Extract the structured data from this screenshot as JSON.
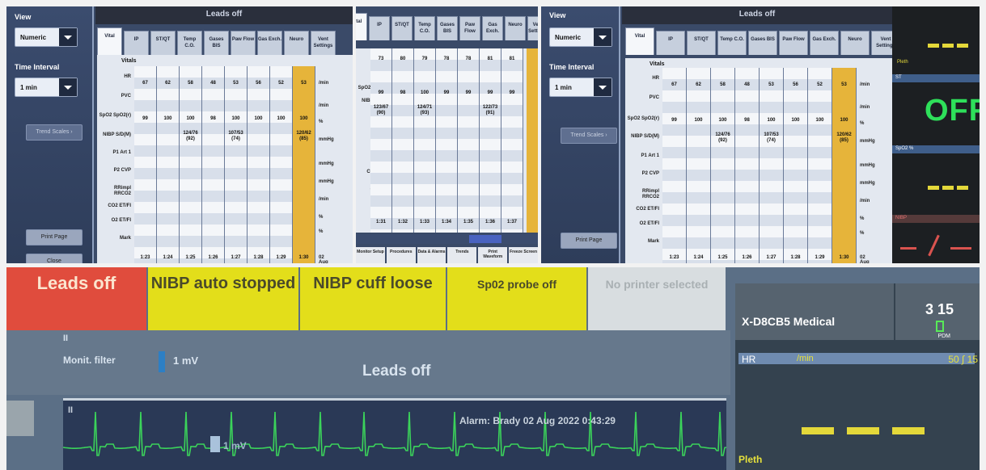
{
  "sidebar": {
    "view_label": "View",
    "view_value": "Numeric",
    "time_label": "Time Interval",
    "time_value": "1 min",
    "trend_scales": "Trend Scales",
    "print_page": "Print Page",
    "close": "Close"
  },
  "topbar": {
    "title": "Leads off"
  },
  "tabs": [
    "Vital",
    "IP",
    "ST/QT",
    "Temp C.O.",
    "Gases BIS",
    "Paw Flow",
    "Gas Exch.",
    "Neuro",
    "Vent Settings"
  ],
  "vitals_header": "Vitals",
  "row_labels": [
    "HR",
    "PVC",
    "SpO2 SpO2(r)",
    "NIBP S/D(M)",
    "P1 Art 1",
    "P2 CVP",
    "RRimpl RRCO2",
    "CO2 ET/FI",
    "O2 ET/FI",
    "Mark"
  ],
  "units": [
    "/min",
    "/min",
    "%",
    "mmHg",
    "mmHg",
    "mmHg",
    "/min",
    "%",
    "%"
  ],
  "columns": [
    {
      "time": "1:23",
      "hr": "67",
      "spo2": "99",
      "nibp": ""
    },
    {
      "time": "1:24",
      "hr": "62",
      "spo2": "100",
      "nibp": ""
    },
    {
      "time": "1:25",
      "hr": "58",
      "spo2": "100",
      "nibp": "124/76 (92)"
    },
    {
      "time": "1:26",
      "hr": "48",
      "spo2": "98",
      "nibp": ""
    },
    {
      "time": "1:27",
      "hr": "53",
      "spo2": "100",
      "nibp": "107/53 (74)"
    },
    {
      "time": "1:28",
      "hr": "56",
      "spo2": "100",
      "nibp": ""
    },
    {
      "time": "1:29",
      "hr": "52",
      "spo2": "100",
      "nibp": ""
    },
    {
      "time": "1:30",
      "hr": "53",
      "spo2": "100",
      "nibp": "120/62 (85)"
    }
  ],
  "date_label": "02 Aug",
  "p2": {
    "row_labels": [
      "HR",
      "PVC",
      "SpO2 SpO2(r)",
      "NIBP S/D(M)",
      "P1 Art 1",
      "P2 CVP",
      "RRimpl RRCO2",
      "CO2 ET/FI",
      "O2 ET/FI",
      "Mark"
    ],
    "columns": [
      {
        "time": "1:31",
        "hr": "73",
        "spo2": "99",
        "nibp": "123/67 (90)"
      },
      {
        "time": "1:32",
        "hr": "80",
        "spo2": "98",
        "nibp": ""
      },
      {
        "time": "1:33",
        "hr": "79",
        "spo2": "100",
        "nibp": "124/71 (93)"
      },
      {
        "time": "1:34",
        "hr": "78",
        "spo2": "99",
        "nibp": ""
      },
      {
        "time": "1:35",
        "hr": "78",
        "spo2": "99",
        "nibp": ""
      },
      {
        "time": "1:36",
        "hr": "81",
        "spo2": "99",
        "nibp": "122/73 (91)"
      },
      {
        "time": "1:37",
        "hr": "81",
        "spo2": "99",
        "nibp": ""
      }
    ],
    "footer_tabs": [
      "Monitor Setup",
      "Procedures",
      "Data & Alarms",
      "Trends",
      "Print Waveform",
      "Freeze Screen"
    ]
  },
  "p3": {
    "off_value": "OFF",
    "pleth": "Pleth",
    "st_label": "ST",
    "spo2_label": "SpO2  %",
    "nibp_label": "NIBP"
  },
  "alarms": [
    {
      "text": "Leads off",
      "color": "#e04c3d"
    },
    {
      "text": "NIBP auto stopped",
      "color": "#e3de1a"
    },
    {
      "text": "NIBP cuff loose",
      "color": "#e3de1a"
    },
    {
      "text": "Sp02 probe off",
      "color": "#e3de1a"
    },
    {
      "text": "No printer selected",
      "color": "#d8dde0"
    }
  ],
  "device": {
    "name": "X-D8CB5 Medical",
    "clock": "3 15",
    "battery_label": "PDM",
    "hr_label": "HR",
    "hr_unit": "/min",
    "hr_limits": "50 ∫ 15",
    "pleth_label": "Pleth"
  },
  "ecg": {
    "lead_top": "II",
    "filter_label": "Monit. filter",
    "filter_value": "1 mV",
    "leads_off": "Leads off",
    "wave_lead": "II",
    "alarm_text": "Alarm: Brady 02 Aug 2022 0:43:29",
    "scale": "1 mV"
  }
}
